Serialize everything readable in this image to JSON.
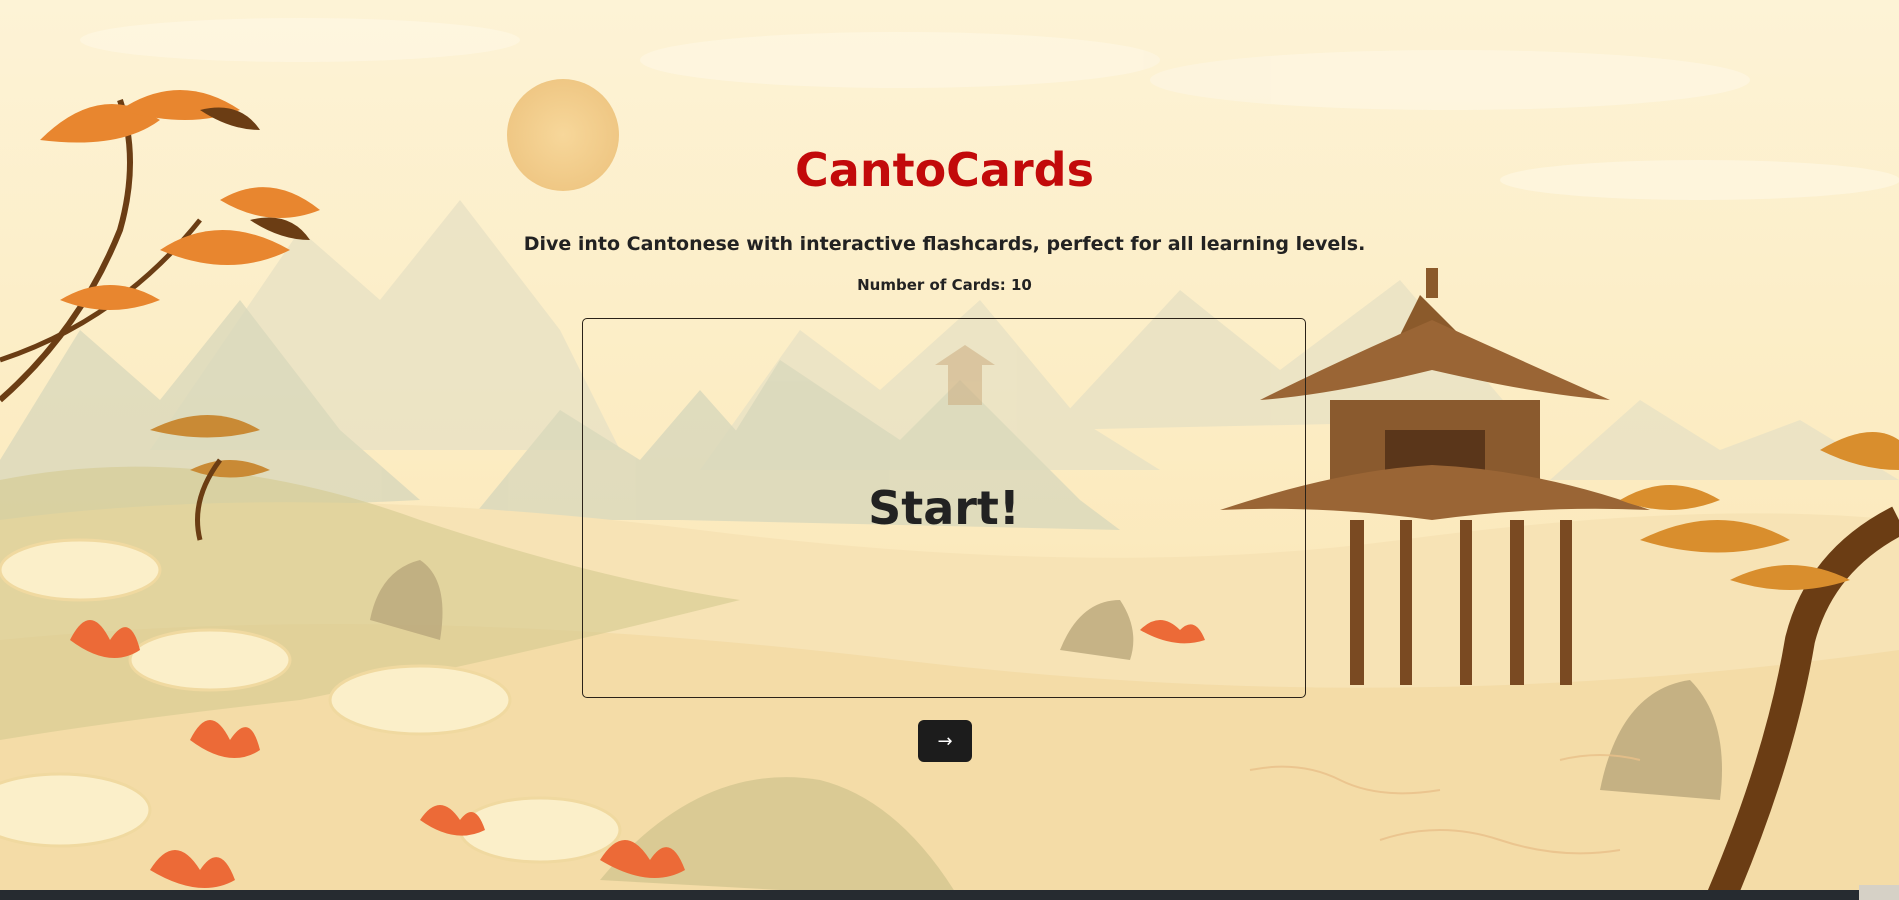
{
  "app": {
    "title": "CantoCards",
    "subtitle": "Dive into Cantonese with interactive flashcards, perfect for all learning levels.",
    "card_count_label": "Number of Cards: 10"
  },
  "flashcard": {
    "front_text": "Start!"
  },
  "controls": {
    "next_label": "→"
  },
  "colors": {
    "background": "#fcefc9",
    "title": "#c20a0a",
    "button": "#1c1c1c"
  }
}
